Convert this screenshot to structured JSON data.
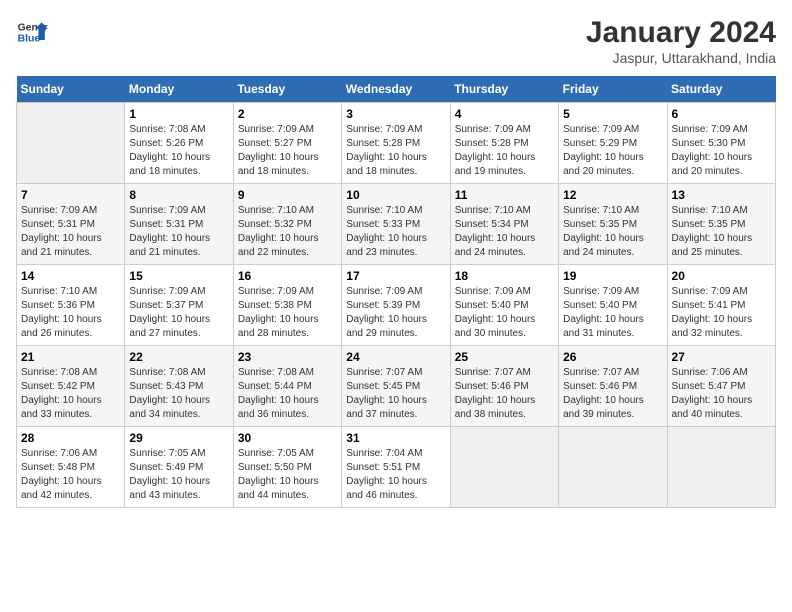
{
  "header": {
    "logo_general": "General",
    "logo_blue": "Blue",
    "month_title": "January 2024",
    "location": "Jaspur, Uttarakhand, India"
  },
  "days_of_week": [
    "Sunday",
    "Monday",
    "Tuesday",
    "Wednesday",
    "Thursday",
    "Friday",
    "Saturday"
  ],
  "weeks": [
    [
      {
        "day": "",
        "empty": true
      },
      {
        "day": "1",
        "sunrise": "7:08 AM",
        "sunset": "5:26 PM",
        "daylight": "10 hours and 18 minutes."
      },
      {
        "day": "2",
        "sunrise": "7:09 AM",
        "sunset": "5:27 PM",
        "daylight": "10 hours and 18 minutes."
      },
      {
        "day": "3",
        "sunrise": "7:09 AM",
        "sunset": "5:28 PM",
        "daylight": "10 hours and 18 minutes."
      },
      {
        "day": "4",
        "sunrise": "7:09 AM",
        "sunset": "5:28 PM",
        "daylight": "10 hours and 19 minutes."
      },
      {
        "day": "5",
        "sunrise": "7:09 AM",
        "sunset": "5:29 PM",
        "daylight": "10 hours and 20 minutes."
      },
      {
        "day": "6",
        "sunrise": "7:09 AM",
        "sunset": "5:30 PM",
        "daylight": "10 hours and 20 minutes."
      }
    ],
    [
      {
        "day": "7",
        "sunrise": "7:09 AM",
        "sunset": "5:31 PM",
        "daylight": "10 hours and 21 minutes."
      },
      {
        "day": "8",
        "sunrise": "7:09 AM",
        "sunset": "5:31 PM",
        "daylight": "10 hours and 21 minutes."
      },
      {
        "day": "9",
        "sunrise": "7:10 AM",
        "sunset": "5:32 PM",
        "daylight": "10 hours and 22 minutes."
      },
      {
        "day": "10",
        "sunrise": "7:10 AM",
        "sunset": "5:33 PM",
        "daylight": "10 hours and 23 minutes."
      },
      {
        "day": "11",
        "sunrise": "7:10 AM",
        "sunset": "5:34 PM",
        "daylight": "10 hours and 24 minutes."
      },
      {
        "day": "12",
        "sunrise": "7:10 AM",
        "sunset": "5:35 PM",
        "daylight": "10 hours and 24 minutes."
      },
      {
        "day": "13",
        "sunrise": "7:10 AM",
        "sunset": "5:35 PM",
        "daylight": "10 hours and 25 minutes."
      }
    ],
    [
      {
        "day": "14",
        "sunrise": "7:10 AM",
        "sunset": "5:36 PM",
        "daylight": "10 hours and 26 minutes."
      },
      {
        "day": "15",
        "sunrise": "7:09 AM",
        "sunset": "5:37 PM",
        "daylight": "10 hours and 27 minutes."
      },
      {
        "day": "16",
        "sunrise": "7:09 AM",
        "sunset": "5:38 PM",
        "daylight": "10 hours and 28 minutes."
      },
      {
        "day": "17",
        "sunrise": "7:09 AM",
        "sunset": "5:39 PM",
        "daylight": "10 hours and 29 minutes."
      },
      {
        "day": "18",
        "sunrise": "7:09 AM",
        "sunset": "5:40 PM",
        "daylight": "10 hours and 30 minutes."
      },
      {
        "day": "19",
        "sunrise": "7:09 AM",
        "sunset": "5:40 PM",
        "daylight": "10 hours and 31 minutes."
      },
      {
        "day": "20",
        "sunrise": "7:09 AM",
        "sunset": "5:41 PM",
        "daylight": "10 hours and 32 minutes."
      }
    ],
    [
      {
        "day": "21",
        "sunrise": "7:08 AM",
        "sunset": "5:42 PM",
        "daylight": "10 hours and 33 minutes."
      },
      {
        "day": "22",
        "sunrise": "7:08 AM",
        "sunset": "5:43 PM",
        "daylight": "10 hours and 34 minutes."
      },
      {
        "day": "23",
        "sunrise": "7:08 AM",
        "sunset": "5:44 PM",
        "daylight": "10 hours and 36 minutes."
      },
      {
        "day": "24",
        "sunrise": "7:07 AM",
        "sunset": "5:45 PM",
        "daylight": "10 hours and 37 minutes."
      },
      {
        "day": "25",
        "sunrise": "7:07 AM",
        "sunset": "5:46 PM",
        "daylight": "10 hours and 38 minutes."
      },
      {
        "day": "26",
        "sunrise": "7:07 AM",
        "sunset": "5:46 PM",
        "daylight": "10 hours and 39 minutes."
      },
      {
        "day": "27",
        "sunrise": "7:06 AM",
        "sunset": "5:47 PM",
        "daylight": "10 hours and 40 minutes."
      }
    ],
    [
      {
        "day": "28",
        "sunrise": "7:06 AM",
        "sunset": "5:48 PM",
        "daylight": "10 hours and 42 minutes."
      },
      {
        "day": "29",
        "sunrise": "7:05 AM",
        "sunset": "5:49 PM",
        "daylight": "10 hours and 43 minutes."
      },
      {
        "day": "30",
        "sunrise": "7:05 AM",
        "sunset": "5:50 PM",
        "daylight": "10 hours and 44 minutes."
      },
      {
        "day": "31",
        "sunrise": "7:04 AM",
        "sunset": "5:51 PM",
        "daylight": "10 hours and 46 minutes."
      },
      {
        "day": "",
        "empty": true
      },
      {
        "day": "",
        "empty": true
      },
      {
        "day": "",
        "empty": true
      }
    ]
  ],
  "labels": {
    "sunrise_prefix": "Sunrise: ",
    "sunset_prefix": "Sunset: ",
    "daylight_prefix": "Daylight: "
  }
}
